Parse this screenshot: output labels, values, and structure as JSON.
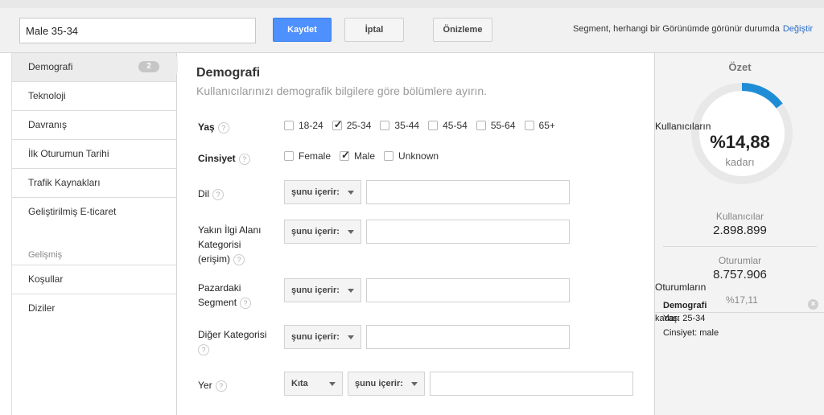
{
  "toolbar": {
    "segment_name": "Male 35-34",
    "save_label": "Kaydet",
    "cancel_label": "İptal",
    "preview_label": "Önizleme",
    "visibility_text": "Segment, herhangi bir Görünümde görünür durumda",
    "change_label": "Değiştir"
  },
  "sidebar": {
    "items": [
      {
        "label": "Demografi",
        "badge": "2"
      },
      {
        "label": "Teknoloji"
      },
      {
        "label": "Davranış"
      },
      {
        "label": "İlk Oturumun Tarihi"
      },
      {
        "label": "Trafik Kaynakları"
      },
      {
        "label": "Geliştirilmiş E-ticaret"
      }
    ],
    "advanced_heading": "Gelişmiş",
    "advanced_items": [
      {
        "label": "Koşullar"
      },
      {
        "label": "Diziler"
      }
    ]
  },
  "main": {
    "title": "Demografi",
    "subtitle": "Kullanıcılarınızı demografik bilgilere göre bölümlere ayırın.",
    "age": {
      "label": "Yaş",
      "options": [
        {
          "label": "18-24",
          "checked": false
        },
        {
          "label": "25-34",
          "checked": true
        },
        {
          "label": "35-44",
          "checked": false
        },
        {
          "label": "45-54",
          "checked": false
        },
        {
          "label": "55-64",
          "checked": false
        },
        {
          "label": "65+",
          "checked": false
        }
      ]
    },
    "gender": {
      "label": "Cinsiyet",
      "options": [
        {
          "label": "Female",
          "checked": false
        },
        {
          "label": "Male",
          "checked": true
        },
        {
          "label": "Unknown",
          "checked": false
        }
      ]
    },
    "language": {
      "label": "Dil",
      "operator": "şunu içerir:",
      "value": ""
    },
    "affinity": {
      "label_line1": "Yakın İlgi Alanı",
      "label_line2": "Kategorisi",
      "label_line3": "(erişim)",
      "operator": "şunu içerir:",
      "value": ""
    },
    "in_market": {
      "label_line1": "Pazardaki",
      "label_line2": "Segment",
      "operator": "şunu içerir:",
      "value": ""
    },
    "other_category": {
      "label_line1": "Diğer Kategorisi",
      "operator": "şunu içerir:",
      "value": ""
    },
    "location": {
      "label": "Yer",
      "scope": "Kıta",
      "operator": "şunu içerir:",
      "value": ""
    },
    "help_glyph": "?"
  },
  "summary": {
    "title": "Özet",
    "users_overlay": "Kullanıcıların",
    "percent": "%14,88",
    "percent_suffix": "kadarı",
    "percent_value": 14.88,
    "users_label": "Kullanıcılar",
    "users_value": "2.898.899",
    "sessions_label": "Oturumlar",
    "sessions_value": "8.757.906",
    "sessions_overlay": "Oturumların",
    "sessions_percent": "%17,11",
    "sessions_kadari": "kadarı",
    "segment_title": "Demografi",
    "segment_age": "Yaş: 25-34",
    "segment_gender": "Cinsiyet: male",
    "accent_color": "#1f8dd6"
  }
}
